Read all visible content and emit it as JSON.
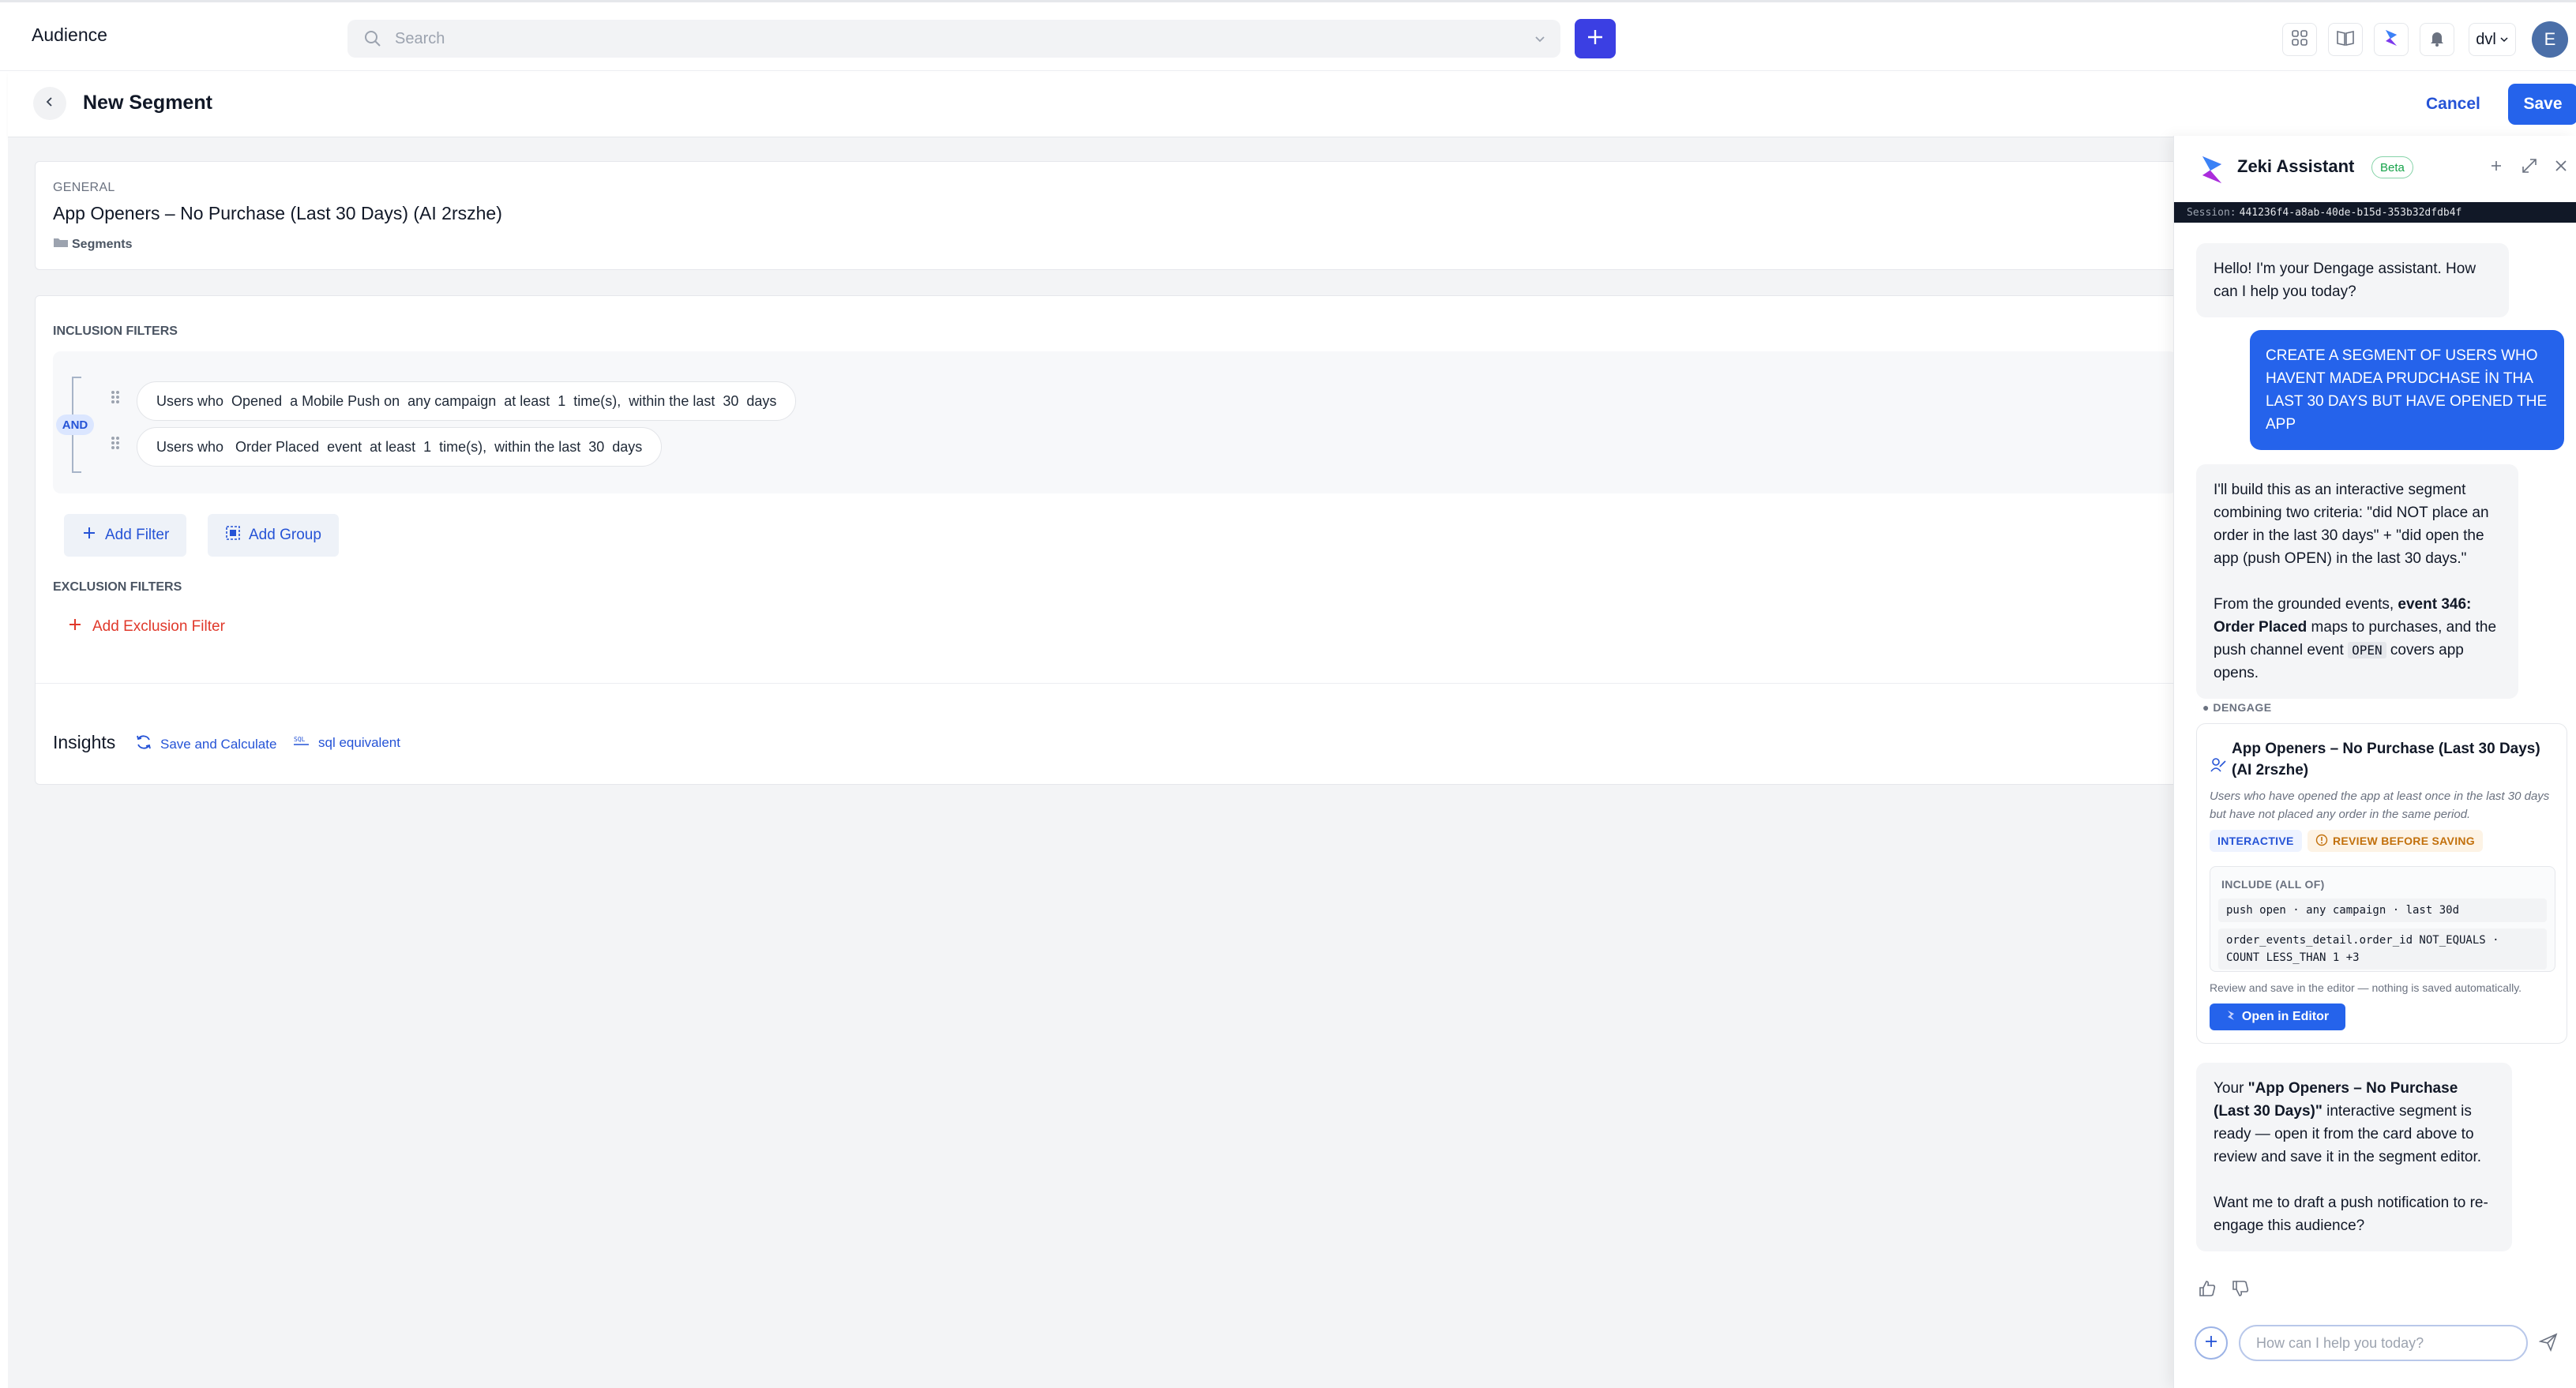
{
  "topbar": {
    "app_title": "Audience",
    "search_placeholder": "Search",
    "account_label": "dvl",
    "avatar_initial": "E"
  },
  "header": {
    "title": "New Segment",
    "cancel_label": "Cancel",
    "save_label": "Save"
  },
  "general": {
    "section_label": "GENERAL",
    "segment_name": "App Openers – No Purchase (Last 30 Days) (AI 2rszhe)",
    "folder": "Segments"
  },
  "filters": {
    "inclusion_label": "INCLUSION FILTERS",
    "and_label": "AND",
    "rows": [
      "Users who  Opened  a Mobile Push on  any campaign  at least  1  time(s),  within the last  30  days",
      "Users who   Order Placed  event  at least  1  time(s),  within the last  30  days"
    ],
    "add_filter_label": "Add Filter",
    "add_group_label": "Add Group",
    "exclusion_label": "EXCLUSION FILTERS",
    "add_exclusion_label": "Add Exclusion Filter"
  },
  "insights": {
    "label": "Insights",
    "save_calc_label": "Save and Calculate",
    "sql_label": "sql equivalent"
  },
  "assistant": {
    "title": "Zeki Assistant",
    "beta_label": "Beta",
    "session_label": "Session:",
    "session_id": "441236f4-a8ab-40de-b15d-353b32dfdb4f",
    "greeting": "Hello! I'm your Dengage assistant. How can I help you today?",
    "user_message": "CREATE A SEGMENT OF USERS WHO HAVENT MADEA PRUDCHASE İN THA LAST 30 DAYS BUT HAVE OPENED THE APP",
    "reply1_p1": "I'll build this as an interactive segment combining two criteria: \"did NOT place an order in the last 30 days\" + \"did open the app (push OPEN) in the last 30 days.\"",
    "reply1_p2_a": "From the grounded events, ",
    "reply1_p2_bold": "event 346: Order Placed",
    "reply1_p2_b": " maps to purchases, and the push channel event ",
    "reply1_p2_code": "OPEN",
    "reply1_p2_c": " covers app opens.",
    "source_label": "● DENGAGE",
    "card": {
      "title": "App Openers – No Purchase (Last 30 Days) (AI 2rszhe)",
      "description": "Users who have opened the app at least once in the last 30 days but have not placed any order in the same period.",
      "tag_interactive": "INTERACTIVE",
      "tag_review": "REVIEW BEFORE SAVING",
      "include_label": "INCLUDE (ALL OF)",
      "criteria": [
        "push open · any campaign · last 30d",
        "order_events_detail.order_id NOT_EQUALS · COUNT LESS_THAN 1 +3"
      ],
      "footnote": "Review and save in the editor — nothing is saved automatically.",
      "open_editor_label": "Open in Editor"
    },
    "reply2_a": "Your ",
    "reply2_bold": "\"App Openers – No Purchase (Last 30 Days)\"",
    "reply2_b": " interactive segment is ready — open it from the card above to review and save it in the segment editor.",
    "reply2_p2": "Want me to draft a push notification to re-engage this audience?",
    "composer_placeholder": "How can I help you today?"
  },
  "colors": {
    "primary": "#2563eb",
    "create_button": "#3b3fe3",
    "exclusion_red": "#e0392b",
    "beta_green": "#16a34a",
    "review_orange": "#c2700c"
  },
  "icons": {
    "search": "search-icon",
    "create": "plus-icon",
    "apps": "apps-grid-icon",
    "docs": "book-icon",
    "assistant": "zeki-logo-icon",
    "notifications": "bell-icon",
    "back": "chevron-left-icon",
    "folder": "folder-icon",
    "drag": "drag-handle-icon",
    "group": "group-icon",
    "refresh": "refresh-icon",
    "sql": "sql-icon",
    "expand": "expand-icon",
    "close": "close-icon",
    "thumbs_up": "thumbs-up-icon",
    "thumbs_down": "thumbs-down-icon",
    "send": "send-icon"
  }
}
